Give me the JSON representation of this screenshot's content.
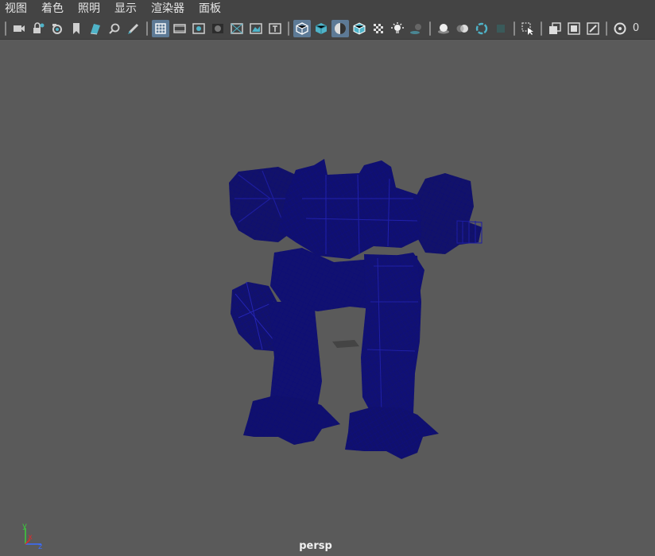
{
  "menu": [
    "视图",
    "着色",
    "照明",
    "显示",
    "渲染器",
    "面板"
  ],
  "toolbar": {
    "groups": [
      [
        "camera-icon",
        "camera-lock-icon",
        "camera-attr-icon",
        "bookmark-icon",
        "image-plane-icon",
        "2d-pan-zoom-icon",
        "grease-pencil-icon"
      ],
      [
        "grid-icon",
        "film-gate-icon",
        "resolution-gate-icon",
        "gate-mask-icon",
        "field-chart-icon",
        "safe-action-icon",
        "safe-title-icon"
      ],
      [
        "wireframe-icon",
        "smooth-shade-icon",
        "shade-all-icon",
        "wireframe-on-shaded-icon",
        "textured-icon",
        "use-all-lights-icon",
        "shadows-icon"
      ],
      [
        "screen-space-ao-icon",
        "motion-blur-icon",
        "multisample-aa-icon",
        "depth-of-field-icon"
      ],
      [
        "isolate-select-icon"
      ],
      [
        "xray-icon",
        "xray-active-icon",
        "xray-joints-icon"
      ],
      [
        "camera-sequencer-icon"
      ]
    ],
    "active": [
      "grid-icon",
      "wireframe-icon",
      "shade-all-icon"
    ],
    "trailing_text": "0"
  },
  "viewport": {
    "camera": "persp",
    "axis": {
      "x": "x",
      "y": "y",
      "z": "z"
    },
    "colors": {
      "background": "#5a5a5a",
      "wireframe": "#0a0a78",
      "axis_x": "#d23030",
      "axis_y": "#3cc83c",
      "axis_z": "#3a6cff"
    }
  }
}
